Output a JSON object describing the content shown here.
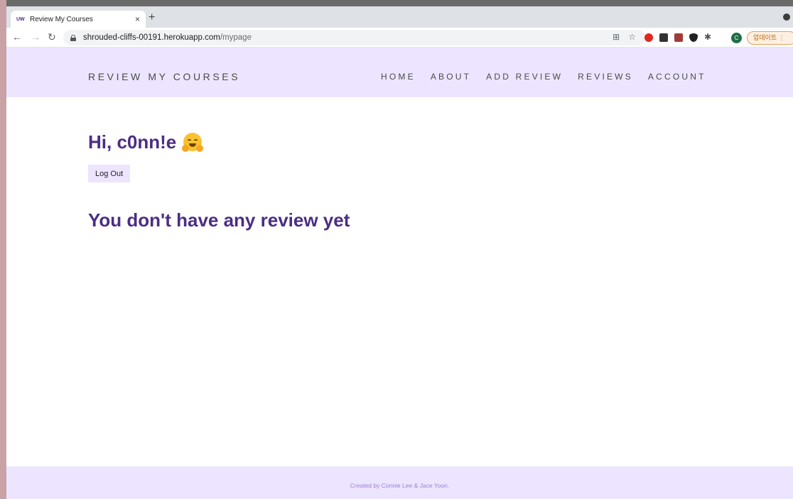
{
  "browser": {
    "tab": {
      "favicon_text": "UW",
      "title": "Review My Courses",
      "close": "×"
    },
    "new_tab": "+",
    "url_host": "shrouded-cliffs-00191.herokuapp.com",
    "url_path": "/mypage",
    "avatar_letter": "C",
    "update_label": "업데이트"
  },
  "site": {
    "brand": "REVIEW MY COURSES",
    "nav": [
      "HOME",
      "ABOUT",
      "ADD REVIEW",
      "REVIEWS",
      "ACCOUNT"
    ],
    "greeting": "Hi, c0nn!e",
    "logout_label": "Log Out",
    "empty_message": "You don't have any review yet",
    "footer": "Created by Connie Lee & Jace Yoon."
  },
  "colors": {
    "accent": "#4b2e83",
    "header_bg": "#ede5ff"
  }
}
